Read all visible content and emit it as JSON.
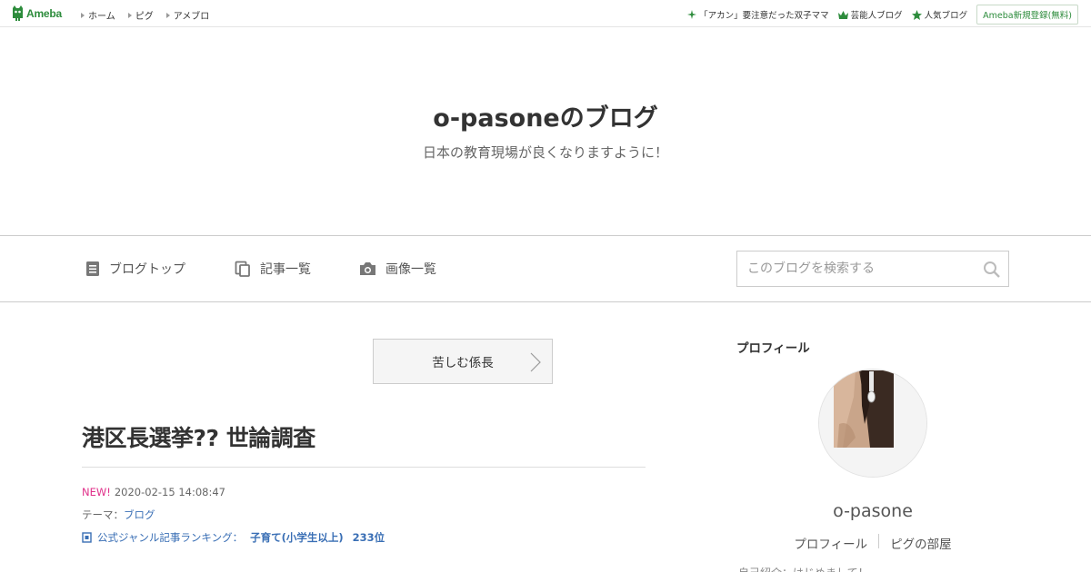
{
  "topbar": {
    "logo_text": "Ameba",
    "nav": [
      "ホーム",
      "ピグ",
      "アメブロ"
    ],
    "right_links": [
      "「アカン」要注意だった双子ママ",
      "芸能人ブログ",
      "人気ブログ"
    ],
    "signup_label": "Ameba新規登録(無料)"
  },
  "blog": {
    "title": "o-pasoneのブログ",
    "description": "日本の教育現場が良くなりますように！"
  },
  "nav": {
    "items": [
      "ブログトップ",
      "記事一覧",
      "画像一覧"
    ],
    "search_placeholder": "このブログを検索する"
  },
  "entry": {
    "prev_label": "苦しむ係長",
    "title": "港区長選挙?? 世論調査",
    "new_label": "NEW!",
    "datetime": "2020-02-15 14:08:47",
    "theme_label": "テーマ：",
    "theme_value": "ブログ",
    "rank_label": "公式ジャンル記事ランキング：",
    "rank_genre": "子育て(小学生以上)",
    "rank_position": "233位"
  },
  "sidebar": {
    "heading": "プロフィール",
    "name": "o-pasone",
    "links": [
      "プロフィール",
      "ピグの部屋"
    ],
    "cut_text": "自己紹介：はじめまして！"
  },
  "colors": {
    "accent_green": "#2d8c3c",
    "link_blue": "#3a6fb5",
    "new_pink": "#e0318a"
  }
}
